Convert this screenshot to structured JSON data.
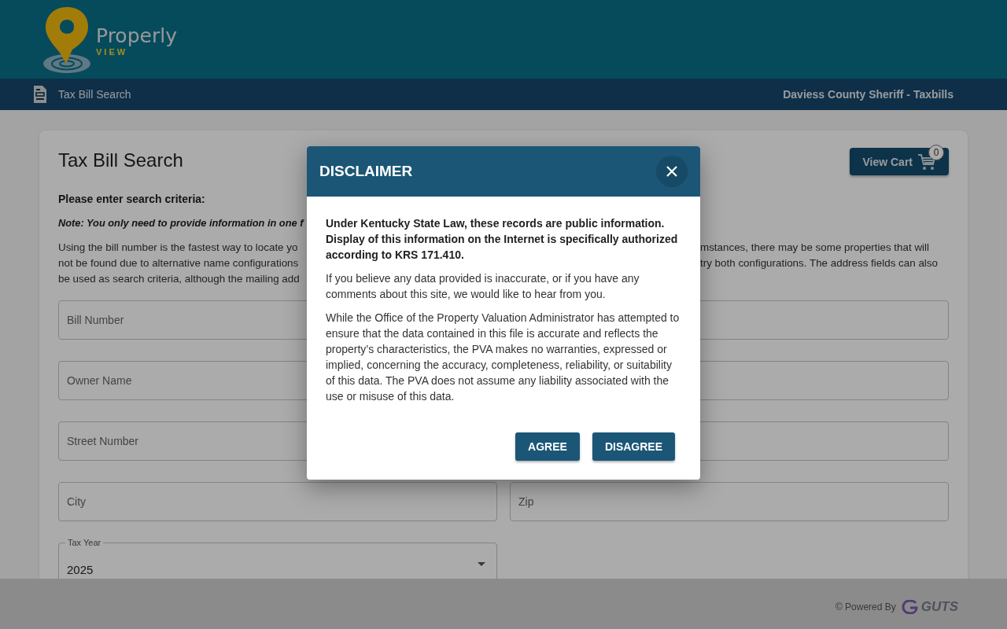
{
  "header": {
    "logo_name": "Properly",
    "logo_sub": "VIEW"
  },
  "nav": {
    "title": "Tax Bill Search",
    "agency": "Daviess County Sheriff - Taxbills"
  },
  "card": {
    "title": "Tax Bill Search",
    "cart_button": "View Cart",
    "cart_count": "0",
    "prompt": "Please enter search criteria:",
    "note": "Note: You only need to provide information in one f",
    "intro_lines": [
      {
        "left": "Using the bill number is the fastest way to locate yo",
        "right": "mstances, there may be some properties that will"
      },
      {
        "left": "not be found due to alternative name configurations",
        "right": "try both configurations. The address fields can also"
      },
      {
        "left": "be used as search criteria, although the mailing add"
      }
    ],
    "fields": [
      {
        "kind": "text",
        "label": "Bill Number"
      },
      {
        "kind": "text"
      },
      {
        "kind": "text",
        "label": "Owner Name"
      },
      {
        "kind": "text"
      },
      {
        "kind": "text",
        "label": "Street Number"
      },
      {
        "kind": "text"
      },
      {
        "kind": "text",
        "label": "City"
      },
      {
        "kind": "text",
        "label": "Zip"
      },
      {
        "kind": "select",
        "label": "Tax Year",
        "value": "2025"
      }
    ]
  },
  "modal": {
    "title": "DISCLAIMER",
    "paragraphs": [
      {
        "kind": "bold",
        "text": "Under Kentucky State Law, these records are public information. Display of this information on the Internet is specifically authorized according to KRS 171.410."
      },
      {
        "kind": "normal",
        "text": "If you believe any data provided is inaccurate, or if you have any comments about this site, we would like to hear from you."
      },
      {
        "kind": "normal",
        "text": "While the Office of the Property Valuation Administrator has attempted to ensure that the data contained in this file is accurate and reflects the property’s characteristics, the PVA makes no warranties, expressed or implied, concerning the accuracy, completeness, reliability, or suitability of this data. The PVA does not assume any liability associated with the use or misuse of this data."
      }
    ],
    "buttons": [
      "AGREE",
      "DISAGREE"
    ]
  },
  "footer": {
    "powered": "© Powered By",
    "brand": "GUTS"
  }
}
